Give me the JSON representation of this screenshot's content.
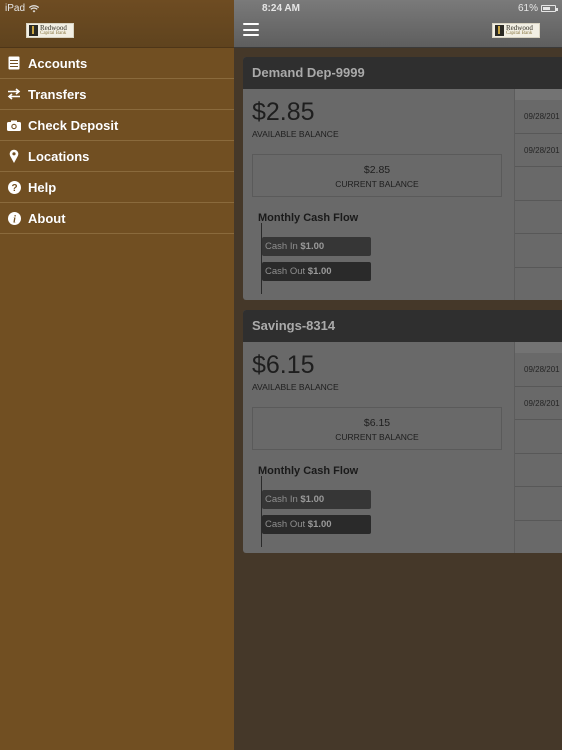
{
  "status_bar": {
    "device": "iPad",
    "time": "8:24 AM",
    "battery_pct_label": "61%",
    "battery_level": 0.61
  },
  "brand": {
    "logo_line1": "Redwood",
    "logo_line2": "Capital Bank"
  },
  "sidebar": {
    "items": [
      {
        "label": "Accounts",
        "icon": "accounts-icon"
      },
      {
        "label": "Transfers",
        "icon": "transfers-icon"
      },
      {
        "label": "Check Deposit",
        "icon": "camera-icon"
      },
      {
        "label": "Locations",
        "icon": "location-pin-icon"
      },
      {
        "label": "Help",
        "icon": "help-icon"
      },
      {
        "label": "About",
        "icon": "info-icon"
      }
    ]
  },
  "accounts": [
    {
      "name": "Demand Dep-9999",
      "available_balance": "$2.85",
      "available_label": "AVAILABLE BALANCE",
      "current_balance": "$2.85",
      "current_label": "CURRENT BALANCE",
      "cash_flow_title": "Monthly Cash Flow",
      "cash_in_label": "Cash In",
      "cash_in_value": "$1.00",
      "cash_out_label": "Cash Out",
      "cash_out_value": "$1.00",
      "transactions": [
        "09/28/201",
        "09/28/201",
        "",
        "",
        "",
        ""
      ]
    },
    {
      "name": "Savings-8314",
      "available_balance": "$6.15",
      "available_label": "AVAILABLE BALANCE",
      "current_balance": "$6.15",
      "current_label": "CURRENT BALANCE",
      "cash_flow_title": "Monthly Cash Flow",
      "cash_in_label": "Cash In",
      "cash_in_value": "$1.00",
      "cash_out_label": "Cash Out",
      "cash_out_value": "$1.00",
      "transactions": [
        "09/28/201",
        "09/28/201",
        "",
        "",
        "",
        ""
      ]
    }
  ]
}
